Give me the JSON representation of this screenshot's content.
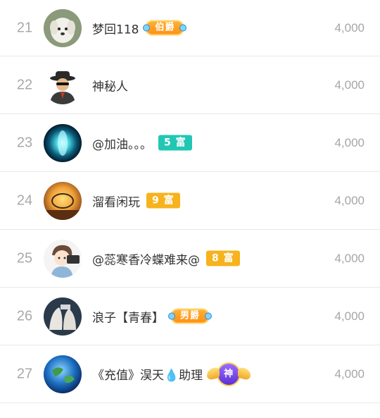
{
  "rows": [
    {
      "rank": "21",
      "name": "梦回118",
      "badge": "伯爵",
      "badge_type": "noble",
      "score": "4,000",
      "avatar": "dog-avatar"
    },
    {
      "rank": "22",
      "name": "神秘人",
      "badge": "",
      "badge_type": "",
      "score": "4,000",
      "avatar": "mystery-man-avatar"
    },
    {
      "rank": "23",
      "name": "@加油。。。",
      "badge": "5 富",
      "badge_type": "teal",
      "score": "4,000",
      "avatar": "blue-glow-avatar"
    },
    {
      "rank": "24",
      "name": "溜看闲玩",
      "badge": "9 富",
      "badge_type": "orange",
      "score": "4,000",
      "avatar": "sunset-avatar"
    },
    {
      "rank": "25",
      "name": "@蕊寒香冷蝶难来@",
      "badge": "8 富",
      "badge_type": "orange",
      "score": "4,000",
      "avatar": "cartoon-boy-avatar"
    },
    {
      "rank": "26",
      "name": "浪子【青春】",
      "badge": "男爵",
      "badge_type": "noble",
      "score": "4,000",
      "avatar": "hands-avatar"
    },
    {
      "rank": "27",
      "name": "《充值》淏天💧助理",
      "badge": "神",
      "badge_type": "god",
      "score": "4,000",
      "avatar": "earth-avatar"
    }
  ],
  "colors": {
    "teal_badge": "#22c7b3",
    "orange_badge": "#f6b31d",
    "rank_text": "#a9a9a9",
    "score_text": "#a6a6a6",
    "divider": "#e8e8e8"
  }
}
